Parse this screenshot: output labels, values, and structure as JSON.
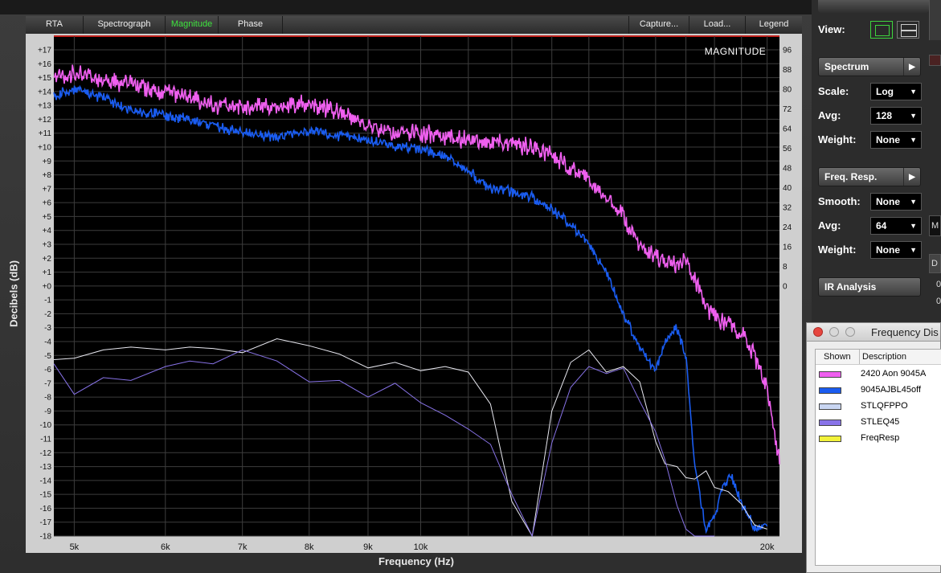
{
  "tabs": [
    "RTA",
    "Spectrograph",
    "Magnitude",
    "Phase"
  ],
  "active_tab": "Magnitude",
  "right_tabs": [
    "Capture...",
    "Load...",
    "Legend"
  ],
  "panel": {
    "view_label": "View:",
    "spectrum_title": "Spectrum",
    "scale_label": "Scale:",
    "scale_value": "Log",
    "avg_label": "Avg:",
    "avg_value": "128",
    "weight_label": "Weight:",
    "weight_value": "None",
    "freqresp_title": "Freq. Resp.",
    "smooth_label": "Smooth:",
    "smooth_value": "None",
    "avg2_label": "Avg:",
    "avg2_value": "64",
    "weight2_label": "Weight:",
    "weight2_value": "None",
    "ir_title": "IR Analysis"
  },
  "strip": {
    "m": "M",
    "d": "D",
    "z1": "0",
    "z2": "0"
  },
  "dialog": {
    "title": "Frequency Dis",
    "col_shown": "Shown",
    "col_desc": "Description",
    "rows": [
      {
        "desc": "2420 Aon 9045A",
        "color": "#ef5fef"
      },
      {
        "desc": "9045AJBL45off",
        "color": "#1a5cf0"
      },
      {
        "desc": "STLQFPPO",
        "color": "#c9d6f2"
      },
      {
        "desc": "STLEQ45",
        "color": "#8873e8"
      },
      {
        "desc": "FreqResp",
        "color": "#f2f23a"
      }
    ]
  },
  "chart_data": {
    "type": "line",
    "title": "MAGNITUDE",
    "xlabel": "Frequency (Hz)",
    "ylabel": "Decibels (dB)",
    "xscale": "log",
    "xlim": [
      4800,
      20500
    ],
    "ylim": [
      -18,
      17.5
    ],
    "x_ticks": [
      {
        "v": 5000,
        "l": "5k"
      },
      {
        "v": 6000,
        "l": "6k"
      },
      {
        "v": 7000,
        "l": "7k"
      },
      {
        "v": 8000,
        "l": "8k"
      },
      {
        "v": 9000,
        "l": "9k"
      },
      {
        "v": 10000,
        "l": "10k"
      },
      {
        "v": 20000,
        "l": "20k"
      }
    ],
    "y_ticks_left": [
      "+17",
      "+16",
      "+15",
      "+14",
      "+13",
      "+12",
      "+11",
      "+10",
      "+9",
      "+8",
      "+7",
      "+6",
      "+5",
      "+4",
      "+3",
      "+2",
      "+1",
      "+0",
      "-1",
      "-2",
      "-3",
      "-4",
      "-5",
      "-6",
      "-7",
      "-8",
      "-9",
      "-10",
      "-11",
      "-12",
      "-13",
      "-14",
      "-15",
      "-16",
      "-17",
      "-18"
    ],
    "y_ticks_right": [
      "96",
      "88",
      "80",
      "72",
      "64",
      "56",
      "48",
      "40",
      "32",
      "24",
      "16",
      "8",
      "0"
    ],
    "grid": true,
    "series": [
      {
        "name": "2420 Aon 9045A",
        "color": "#ef5fef",
        "x": [
          4800,
          5000,
          5300,
          5600,
          6000,
          6300,
          6600,
          7000,
          7500,
          8000,
          8500,
          9000,
          9500,
          10000,
          10500,
          11000,
          11500,
          12000,
          12500,
          13000,
          13500,
          14000,
          14500,
          15000,
          15500,
          16000,
          16300,
          16700,
          17000,
          17300,
          17700,
          18000,
          18500,
          19000,
          19500,
          20000,
          20500
        ],
        "y": [
          15,
          15.3,
          14.8,
          14.5,
          14,
          13.5,
          13,
          13,
          12.8,
          13.2,
          12.5,
          11.5,
          11,
          11,
          10.8,
          10.5,
          10.4,
          10.2,
          10,
          9.5,
          8.5,
          7.5,
          6.5,
          5,
          3,
          2,
          1.7,
          1.6,
          1.8,
          0.5,
          -1.5,
          -2.2,
          -2.8,
          -3.3,
          -5,
          -7.5,
          -12.5
        ]
      },
      {
        "name": "9045AJBL45off",
        "color": "#1a5cf0",
        "x": [
          4800,
          5000,
          5300,
          5600,
          6000,
          6300,
          6600,
          7000,
          7500,
          8000,
          8500,
          9000,
          9500,
          10000,
          10500,
          11000,
          11500,
          12000,
          12500,
          13000,
          13500,
          14000,
          14500,
          15000,
          15500,
          16000,
          16300,
          16700,
          17000,
          17300,
          17700,
          18000,
          18300,
          18600,
          19000,
          19500,
          20000
        ],
        "y": [
          13.7,
          14.2,
          13.5,
          12.6,
          12.3,
          12,
          11.6,
          11,
          10.7,
          11.2,
          10.8,
          10.5,
          10.1,
          9.8,
          9.4,
          8.3,
          7,
          6.8,
          6.4,
          5.5,
          4.5,
          3,
          1,
          -2,
          -4.5,
          -6,
          -4,
          -3,
          -5,
          -13,
          -17.5,
          -16.5,
          -14.5,
          -13.5,
          -15.5,
          -17.5,
          -17.2
        ]
      },
      {
        "name": "STLQFPPO",
        "color": "#e8e8f0",
        "x": [
          4800,
          5000,
          5300,
          5600,
          6000,
          6300,
          6600,
          7000,
          7500,
          8000,
          8500,
          9000,
          9500,
          10000,
          10500,
          11000,
          11500,
          12000,
          12500,
          13000,
          13500,
          14000,
          14500,
          15000,
          15500,
          16000,
          16300,
          16700,
          17000,
          17300,
          17700,
          18000,
          18500,
          19000,
          19500,
          20000
        ],
        "y": [
          -5.3,
          -5.2,
          -4.6,
          -4.4,
          -4.6,
          -4.4,
          -4.5,
          -4.8,
          -3.8,
          -4.3,
          -4.9,
          -5.9,
          -5.5,
          -6.1,
          -5.8,
          -6.2,
          -8.5,
          -15.5,
          -18,
          -9,
          -5.5,
          -4.6,
          -6.2,
          -5.8,
          -6.9,
          -11.2,
          -12.8,
          -13,
          -13.8,
          -13.9,
          -13.3,
          -14.5,
          -14.8,
          -15.7,
          -17.2,
          -17.5
        ]
      },
      {
        "name": "STLEQ45",
        "color": "#8873e8",
        "x": [
          4800,
          5000,
          5300,
          5600,
          6000,
          6300,
          6600,
          7000,
          7500,
          8000,
          8500,
          9000,
          9500,
          10000,
          10500,
          11000,
          11500,
          12000,
          12500,
          13000,
          13500,
          14000,
          14500,
          15000,
          15500,
          16000,
          16300,
          16700,
          17000,
          17300,
          17700,
          18000
        ],
        "y": [
          -5.6,
          -7.8,
          -6.6,
          -6.8,
          -5.8,
          -5.4,
          -5.6,
          -4.6,
          -5.4,
          -6.9,
          -6.8,
          -8,
          -7,
          -8.4,
          -9.3,
          -10.3,
          -11.4,
          -15,
          -18,
          -11.3,
          -7.3,
          -5.8,
          -6.3,
          -5.9,
          -8.3,
          -10.5,
          -12.5,
          -15.8,
          -17.5,
          -18,
          -18,
          -18
        ]
      }
    ]
  }
}
